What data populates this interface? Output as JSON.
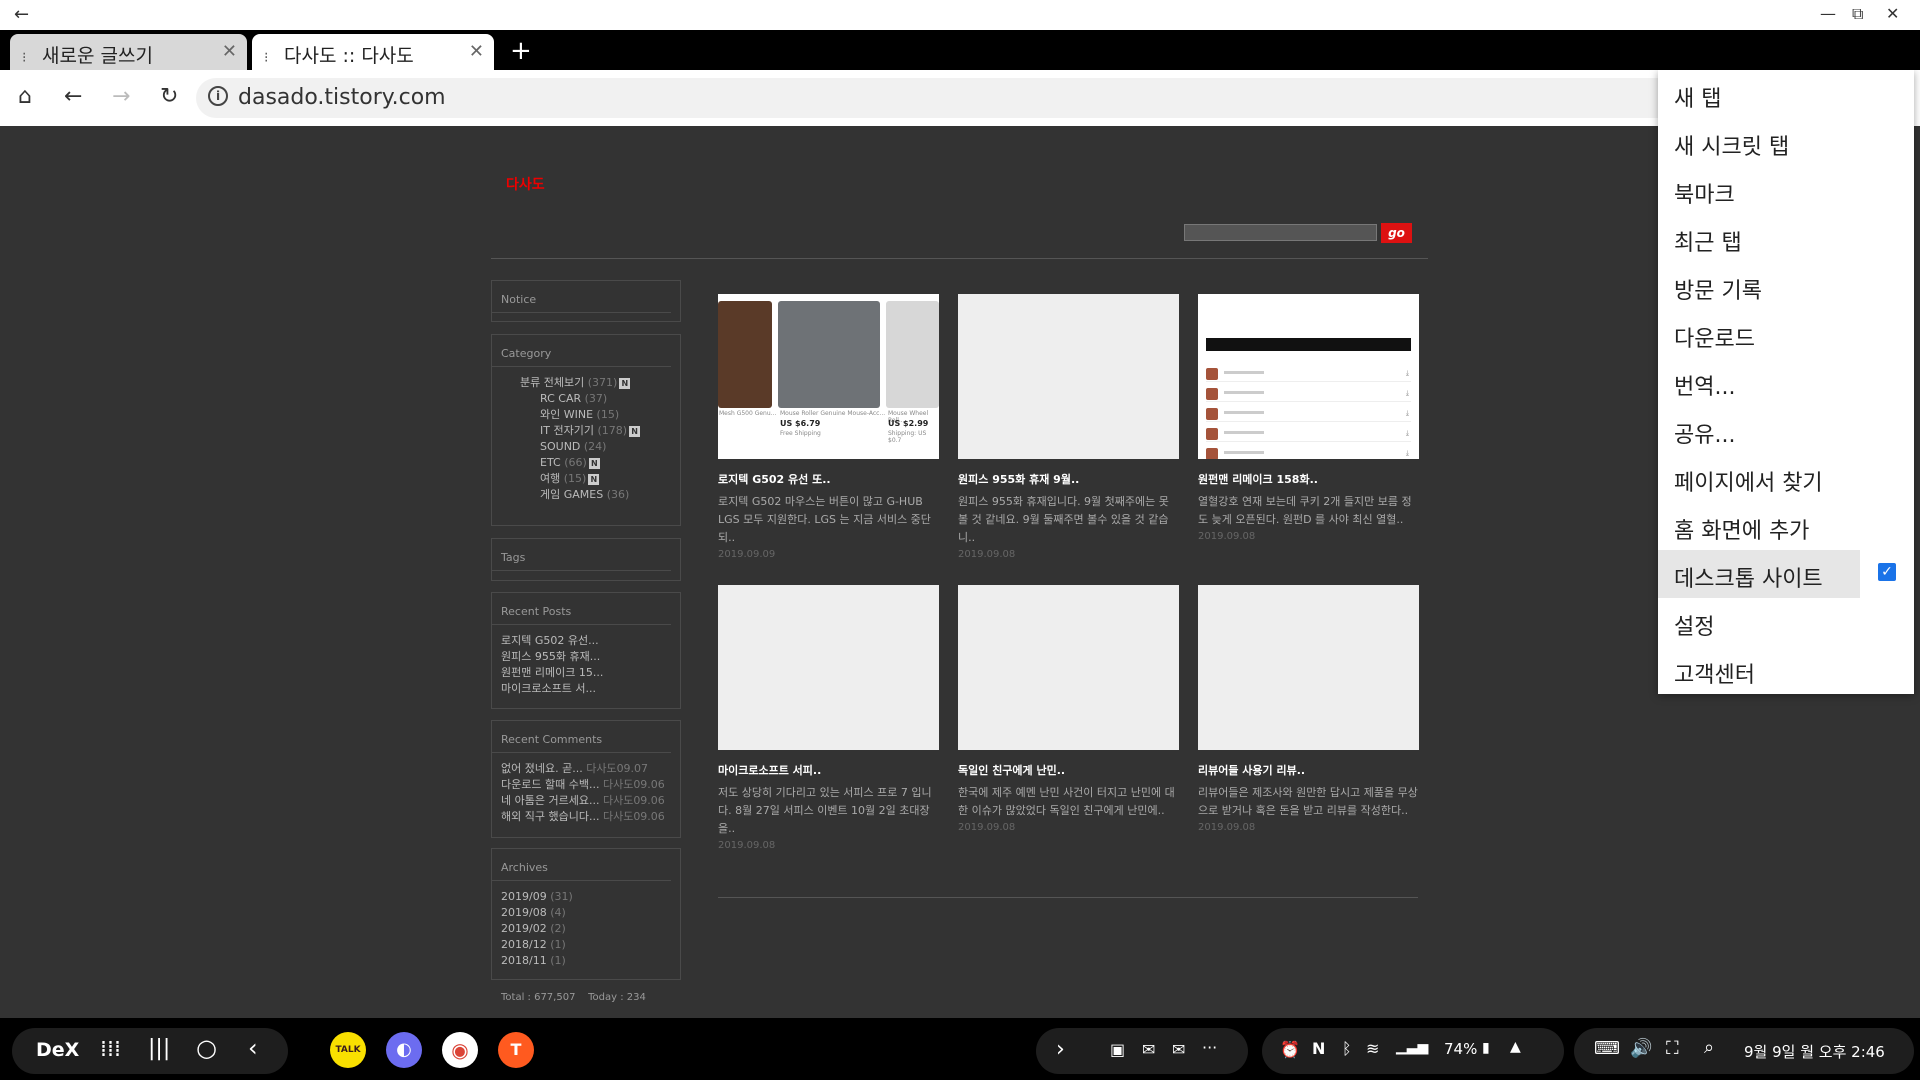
{
  "window": {
    "back_icon": "←",
    "controls": [
      "—",
      "⧉",
      "✕"
    ]
  },
  "tabs": [
    {
      "title": "새로운 글쓰기",
      "close": "✕"
    },
    {
      "title": "다사도 :: 다사도",
      "close": "✕"
    }
  ],
  "new_tab_icon": "+",
  "toolbar": {
    "home_icon": "⌂",
    "back_icon": "←",
    "forward_icon": "→",
    "reload_icon": "↻",
    "info_icon": "i",
    "url": "dasado.tistory.com"
  },
  "site": {
    "title": "다사도",
    "search_button": "go",
    "sidebar": {
      "notice_title": "Notice",
      "category_title": "Category",
      "categories": [
        {
          "name": "분류 전체보기",
          "count": "(371)",
          "new": "N",
          "level": 0
        },
        {
          "name": "RC CAR",
          "count": "(37)",
          "new": "",
          "level": 1
        },
        {
          "name": "와인 WINE",
          "count": "(15)",
          "new": "",
          "level": 1
        },
        {
          "name": "IT 전자기기",
          "count": "(178)",
          "new": "N",
          "level": 1
        },
        {
          "name": "SOUND",
          "count": "(24)",
          "new": "",
          "level": 1
        },
        {
          "name": "ETC",
          "count": "(66)",
          "new": "N",
          "level": 1
        },
        {
          "name": "여행",
          "count": "(15)",
          "new": "N",
          "level": 1
        },
        {
          "name": "게임 GAMES",
          "count": "(36)",
          "new": "",
          "level": 1
        }
      ],
      "tags_title": "Tags",
      "recent_posts_title": "Recent Posts",
      "recent_posts": [
        "로지텍 G502 유선...",
        "원피스 955화 휴재...",
        "원펀맨 리메이크 15...",
        "마이크로소프트 서..."
      ],
      "recent_comments_title": "Recent Comments",
      "recent_comments": [
        {
          "text": "없어 졌네요. 곧...",
          "meta": "다사도09.07"
        },
        {
          "text": "다운로드 할때 수백...",
          "meta": "다사도09.06"
        },
        {
          "text": "네 아톰은 거르세요...",
          "meta": "다사도09.06"
        },
        {
          "text": "해외 직구 했습니다...",
          "meta": "다사도09.06"
        }
      ],
      "archives_title": "Archives",
      "archives": [
        {
          "month": "2019/09",
          "count": "(31)"
        },
        {
          "month": "2019/08",
          "count": "(4)"
        },
        {
          "month": "2019/02",
          "count": "(2)"
        },
        {
          "month": "2018/12",
          "count": "(1)"
        },
        {
          "month": "2018/11",
          "count": "(1)"
        }
      ],
      "stats": "Total : 677,507    Today : 234"
    },
    "posts": [
      {
        "title": "로지텍 G502 유선 또..",
        "excerpt": "로지텍 G502 마우스는 버튼이 많고 G-HUB LGS 모두 지원한다. LGS 는 지금 서비스 중단되..",
        "date": "2019.09.09"
      },
      {
        "title": "원피스 955화 휴재 9월..",
        "excerpt": "원피스 955화 휴재입니다. 9월 첫째주에는 못 볼 것 같네요. 9월 둘째주면 볼수 있을 것 같습니..",
        "date": "2019.09.08"
      },
      {
        "title": "원펀맨 리메이크 158화..",
        "excerpt": " 열혈강호 연재 보는데 쿠키 2개 들지만 보름 정도 늦게 오픈된다. 원펀D 를 사야 최신 열혈..",
        "date": "2019.09.08"
      },
      {
        "title": "마이크로소프트 서피..",
        "excerpt": "저도 상당히 기다리고 있는 서피스 프로 7 입니다. 8월 27일 서피스 이벤트 10월 2일 초대장을..",
        "date": "2019.09.08"
      },
      {
        "title": "독일인 친구에게 난민..",
        "excerpt": "한국에 제주 예멘 난민 사건이 터지고 난민에 대한 이슈가 많았었다 독일인 친구에게 난민에..",
        "date": "2019.09.08"
      },
      {
        "title": "리뷰어들 사용기 리뷰..",
        "excerpt": "리뷰어들은 제조사와 원만한 답시고 제품을 무상으로 받거나 혹은 돈을 받고 리뷰를 작성한다..",
        "date": "2019.09.08"
      }
    ],
    "thumb1": {
      "labels": [
        "Mesh G500 Genu...",
        "Mouse Roller Genuine Mouse-Acc...",
        "Mouse Wheel Roll..."
      ],
      "prices": [
        "US $6.79",
        "US $2.99"
      ],
      "shipping": [
        "Free Shipping",
        "Shipping: US $0.7"
      ]
    }
  },
  "menu": {
    "items": [
      "새 탭",
      "새 시크릿 탭",
      "북마크",
      "최근 탭",
      "방문 기록",
      "다운로드",
      "번역...",
      "공유...",
      "페이지에서 찾기",
      "홈 화면에 추가",
      "데스크톱 사이트",
      "설정",
      "고객센터"
    ],
    "desktop_site_checked": true,
    "check_icon": "✓"
  },
  "taskbar": {
    "dex_label": "DeX",
    "apps": [
      {
        "name": "KakaoTalk",
        "label": "TALK",
        "color": "#f9e000"
      },
      {
        "name": "Samsung Internet",
        "label": "◐",
        "color": "#6c6cf0"
      },
      {
        "name": "Chrome",
        "label": "◉",
        "color": "#ffffff"
      },
      {
        "name": "Tistory",
        "label": "T",
        "color": "#ff5a1f"
      }
    ],
    "battery": "74%",
    "datetime": "9월 9일 월 오후 2:46"
  }
}
